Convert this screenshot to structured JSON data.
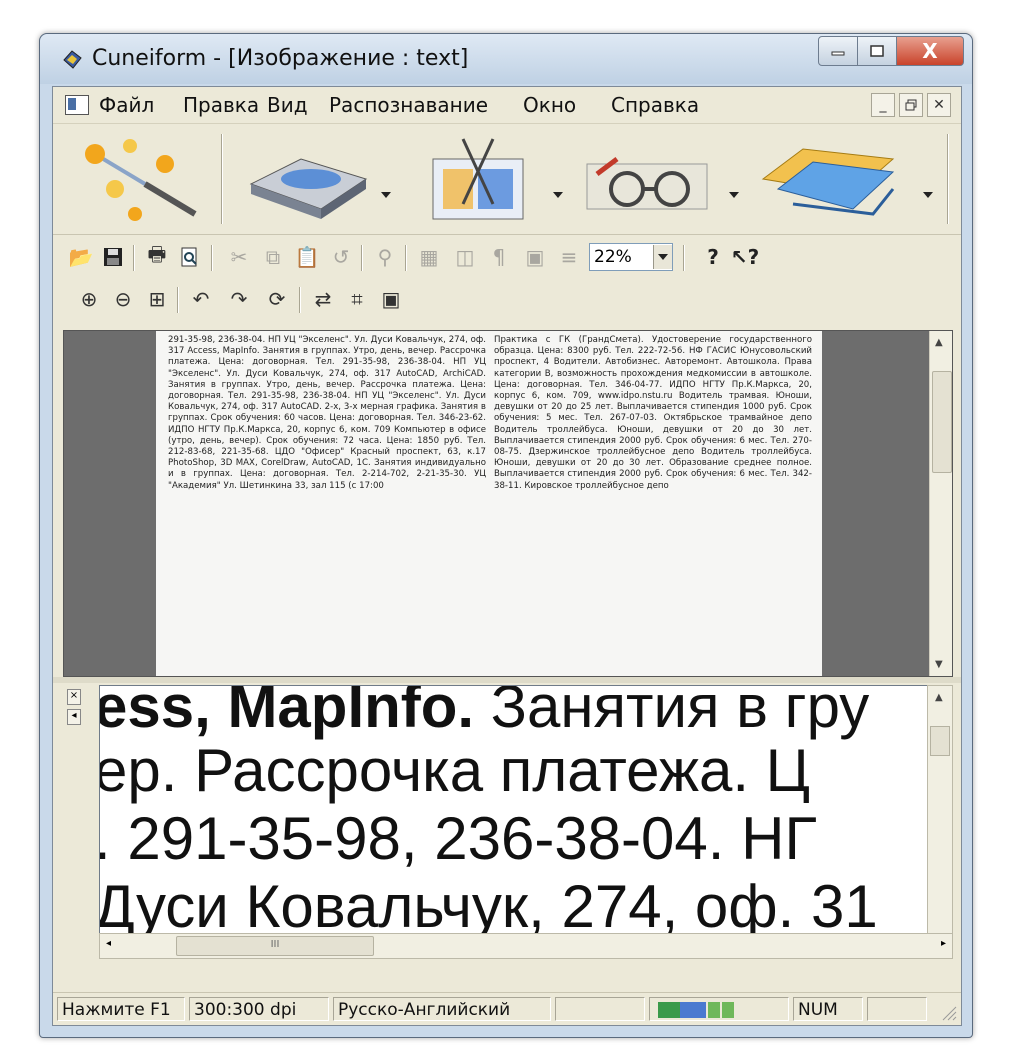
{
  "window": {
    "title": "Cuneiform - [Изображение : text]",
    "close_glyph": "X"
  },
  "menu": [
    "Файл",
    "Правка",
    "Вид",
    "Распознавание",
    "Окно",
    "Справка"
  ],
  "toolbar": {
    "zoom_value": "22%"
  },
  "document_image": {
    "left_column": "291-35-98, 236-38-04. НП УЦ \"Экселенс\". Ул. Дуси Ковальчук, 274, оф. 317 Access, MapInfo. Занятия в группах. Утро, день, вечер. Рассрочка платежа. Цена: договорная. Тел. 291-35-98, 236-38-04. НП УЦ \"Экселенс\". Ул. Дуси Ковальчук, 274, оф. 317 AutoCAD, ArchiCAD. Занятия в группах. Утро, день, вечер. Рассрочка платежа. Цена: договорная. Тел. 291-35-98, 236-38-04. НП УЦ \"Экселенс\". Ул. Дуси Ковальчук, 274, оф. 317 AutoCAD. 2-х, 3-х мерная графика. Занятия в группах. Срок обучения: 60 часов. Цена: договорная. Тел. 346-23-62. ИДПО НГТУ Пр.К.Маркса, 20, корпус 6, ком. 709 Компьютер в офисе (утро, день, вечер). Срок обучения: 72 часа. Цена: 1850 руб. Тел. 212-83-68, 221-35-68. ЦДО \"Офисер\" Красный проспект, 63, к.17 PhotoShop, 3D MAX, CorelDraw, AutoCAD, 1С. Занятия индивидуально и в группах. Цена: договорная. Тел. 2-214-702, 2-21-35-30. УЦ \"Академия\" Ул. Шетинкина 33, зал 115 (с 17:00",
    "right_column": "Практика с ГК (ГрандСмета). Удостоверение государственного образца. Цена: 8300 руб. Тел. 222-72-56. НФ ГАСИС Юнусовольский проспект, 4 Водители. Автобизнес. Авторемонт. Автошкола. Права категории В, возможность прохождения медкомиссии в автошколе. Цена: договорная. Тел. 346-04-77. ИДПО НГТУ Пр.К.Маркса, 20, корпус 6, ком. 709, www.idpo.nstu.ru Водитель трамвая. Юноши, девушки от 20 до 25 лет. Выплачивается стипендия 1000 руб. Срок обучения: 5 мес. Тел. 267-07-03. Октябрьское трамвайное депо Водитель троллейбуса. Юноши, девушки от 20 до 30 лет. Выплачивается стипендия 2000 руб. Срок обучения: 6 мес. Тел. 270-08-75. Дзержинское троллейбусное депо Водитель троллейбуса. Юноши, девушки от 20 до 30 лет. Образование среднее полное. Выплачивается стипендия 2000 руб. Срок обучения: 6 мес. Тел. 342-38-11. Кировское троллейбусное депо"
  },
  "zoom_lines": [
    {
      "a": "ess, ",
      "b": "MapInfo.",
      "c": " Занятия в гру"
    },
    {
      "a": "ер. Рассрочка платежа. Ц",
      "b": "",
      "c": ""
    },
    {
      "a": ". 291-35-98, 236-38-04. НГ",
      "b": "",
      "c": ""
    },
    {
      "a": "Дуси Ковальчук, 274, оф. 31",
      "b": "",
      "c": ""
    }
  ],
  "scrollbar_thumb_label": "III",
  "status": {
    "hint": "Нажмите F1",
    "dpi": "300:300 dpi",
    "language": "Русско-Английский",
    "num": "NUM"
  },
  "colors": {
    "title_bg": "#c9d9ea",
    "client_bg": "#ece9d8",
    "close_red": "#c9432b"
  }
}
